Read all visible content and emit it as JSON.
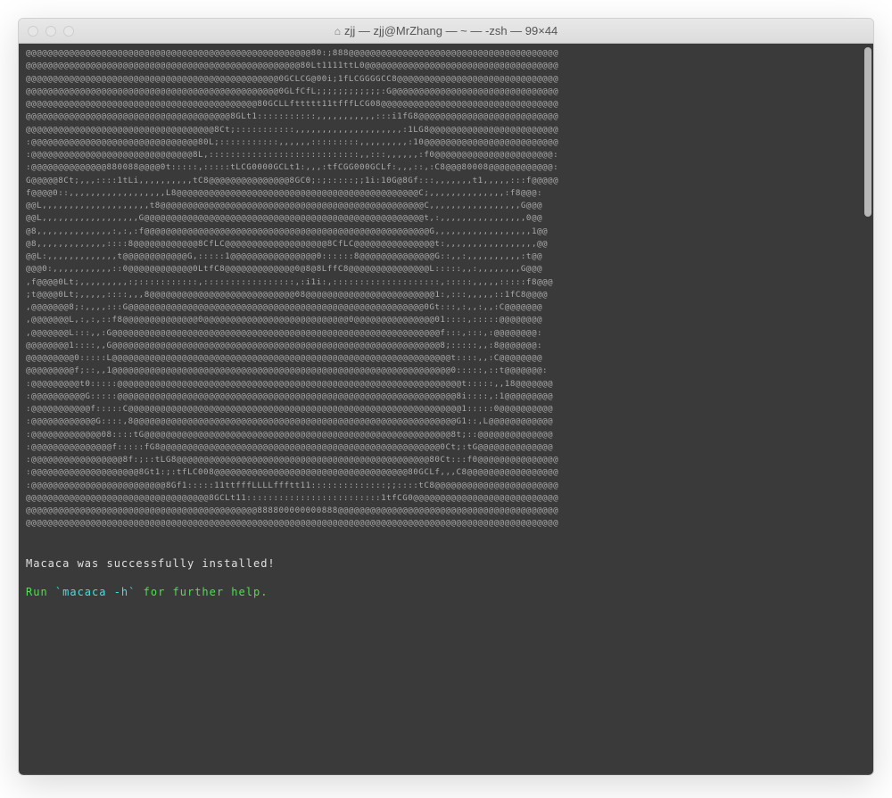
{
  "window": {
    "title": "zjj — zjj@MrZhang — ~ — -zsh — 99×44",
    "home_icon": "⌂"
  },
  "ascii_art": [
    "@@@@@@@@@@@@@@@@@@@@@@@@@@@@@@@@@@@@@@@@@@@@@@@@@@@@@80:;888@@@@@@@@@@@@@@@@@@@@@@@@@@@@@@@@@@@@@@@",
    "@@@@@@@@@@@@@@@@@@@@@@@@@@@@@@@@@@@@@@@@@@@@@@@@@@@80Lt1111ttL0@@@@@@@@@@@@@@@@@@@@@@@@@@@@@@@@@@@@",
    "@@@@@@@@@@@@@@@@@@@@@@@@@@@@@@@@@@@@@@@@@@@@@@@0GCLCG@00i;1fLCGGGGCC8@@@@@@@@@@@@@@@@@@@@@@@@@@@@@@",
    "@@@@@@@@@@@@@@@@@@@@@@@@@@@@@@@@@@@@@@@@@@@@@@@0GLfCfL;;;;;;;;;;;;:G@@@@@@@@@@@@@@@@@@@@@@@@@@@@@@@",
    "@@@@@@@@@@@@@@@@@@@@@@@@@@@@@@@@@@@@@@@@@@@80GCLLfttttt11tfffLCG08@@@@@@@@@@@@@@@@@@@@@@@@@@@@@@@@@",
    "@@@@@@@@@@@@@@@@@@@@@@@@@@@@@@@@@@@@@@8GLt1:::::::::::,,,,,,,,,,,:::i1fG8@@@@@@@@@@@@@@@@@@@@@@@@@@",
    "@@@@@@@@@@@@@@@@@@@@@@@@@@@@@@@@@@@8Ct;:::::::::::,,,,,,,,,,,,,,,,,,,,:1LG8@@@@@@@@@@@@@@@@@@@@@@@@",
    ":@@@@@@@@@@@@@@@@@@@@@@@@@@@@@@@80L;:::::::::::,,,,,,:::::::::,,,,,,,,,:10@@@@@@@@@@@@@@@@@@@@@@@@@",
    ":@@@@@@@@@@@@@@@@@@@@@@@@@@@@@@8L,::::::::::::::::::::::::::::,,:::,,,,,,:f0@@@@@@@@@@@@@@@@@@@@@@:",
    ":@@@@@@@@@@@@@@880088@@@@0t:::::,:::::tLCG0000GCLt1:,,,:tfCGG000GCLf:,,,::,:C8@@@80008@@@@@@@@@@@@:",
    "G@@@@@8Ct;,,,::::1tLi,,,,,,,,,,tC8@@@@@@@@@@@@@@@8GC0;:;:::::;;1i:10G@8Gf:::,,,,,,,t1,,,,,:::f@@@@@",
    "f@@@@0::,,,,,,,,,,,,,,,,,,L8@@@@@@@@@@@@@@@@@@@@@@@@@@@@@@@@@@@@@@@@@@@@@C;,,,,,,,,,,,,,,:f8@@@:",
    "@@L,,,,,,,,,,,,,,,,,,,,t8@@@@@@@@@@@@@@@@@@@@@@@@@@@@@@@@@@@@@@@@@@@@@@@@@C,,,,,,,,,,,,,,,,,G@@@",
    "@@L,,,,,,,,,,,,,,,,,,G@@@@@@@@@@@@@@@@@@@@@@@@@@@@@@@@@@@@@@@@@@@@@@@@@@@@t,:,,,,,,,,,,,,,,,,0@@",
    "@8,,,,,,,,,,,,,,:,:,:f@@@@@@@@@@@@@@@@@@@@@@@@@@@@@@@@@@@@@@@@@@@@@@@@@@@@@G,,,,,,,,,,,,,,,,,,1@@",
    "@8,,,,,,,,,,,,,::::8@@@@@@@@@@@@8CfLC@@@@@@@@@@@@@@@@@@@8CfLC@@@@@@@@@@@@@@@t:,,,,,,,,,,,,,,,,,@@",
    "@@L:,,,,,,,,,,,,,t@@@@@@@@@@@@G,:::::1@@@@@@@@@@@@@@@@0::::::8@@@@@@@@@@@@@@G::,,:,,,,,,,,,,:t@@",
    "@@@0:,,,,,,,,,,,::0@@@@@@@@@@@@0LtfC8@@@@@@@@@@@@@0@8@8LffC8@@@@@@@@@@@@@@@L:::::,,:,,,,,,,,G@@@",
    ",f@@@@0Lt;,,,,,,,,,:;:::::::::::,:::::::::::::::::,:i1i:,::::::::::::::::::::,:::::,,,,,:::::f8@@@",
    ";t@@@@0Lt;,,,,,::::,,,8@@@@@@@@@@@@@@@@@@@@@@@@@@@08@@@@@@@@@@@@@@@@@@@@@@@@1:,:::,,,,,::1fC8@@@@",
    ",@@@@@@@8;:,,,,:::G@@@@@@@@@@@@@@@@@@@@@@@@@@@@@@@@@@@@@@@@@@@@@@@@@@@@@@@0Gt:::,:,,:,,:C@@@@@@@",
    ",@@@@@@@L,:,:,::f8@@@@@@@@@@@@@@0@@@@@@@@@@@@@@@@@@@@@@@@@@@0@@@@@@@@@@@@@@@01::::,:::::@@@@@@@@",
    ",@@@@@@@L:::,,:G@@@@@@@@@@@@@@@@@@@@@@@@@@@@@@@@@@@@@@@@@@@@@@@@@@@@@@@@@@@@@f:::,:::,:@@@@@@@@:",
    "@@@@@@@@1::::,,G@@@@@@@@@@@@@@@@@@@@@@@@@@@@@@@@@@@@@@@@@@@@@@@@@@@@@@@@@@@@@8;:::::,,:8@@@@@@@:",
    "@@@@@@@@@0:::::L@@@@@@@@@@@@@@@@@@@@@@@@@@@@@@@@@@@@@@@@@@@@@@@@@@@@@@@@@@@@@@@t::::,,:C@@@@@@@@",
    "@@@@@@@@@f;::,,1@@@@@@@@@@@@@@@@@@@@@@@@@@@@@@@@@@@@@@@@@@@@@@@@@@@@@@@@@@@@@@@0:::::,::t@@@@@@@:",
    ":@@@@@@@@@t0:::::@@@@@@@@@@@@@@@@@@@@@@@@@@@@@@@@@@@@@@@@@@@@@@@@@@@@@@@@@@@@@@@@t:::::,,18@@@@@@@",
    ":@@@@@@@@@@G:::::@@@@@@@@@@@@@@@@@@@@@@@@@@@@@@@@@@@@@@@@@@@@@@@@@@@@@@@@@@@@@@@8i::::,:1@@@@@@@@@",
    ":@@@@@@@@@@@f:::::C@@@@@@@@@@@@@@@@@@@@@@@@@@@@@@@@@@@@@@@@@@@@@@@@@@@@@@@@@@@@@@1:::::0@@@@@@@@@@",
    ":@@@@@@@@@@@@G::::,8@@@@@@@@@@@@@@@@@@@@@@@@@@@@@@@@@@@@@@@@@@@@@@@@@@@@@@@@@@@@G1::,L@@@@@@@@@@@@",
    ":@@@@@@@@@@@@@08::::tG@@@@@@@@@@@@@@@@@@@@@@@@@@@@@@@@@@@@@@@@@@@@@@@@@@@@@@@@@8t;::@@@@@@@@@@@@@@",
    ":@@@@@@@@@@@@@@@f:::::fG8@@@@@@@@@@@@@@@@@@@@@@@@@@@@@@@@@@@@@@@@@@@@@@@@@@@@0Ct;:tG@@@@@@@@@@@@@@",
    ":@@@@@@@@@@@@@@@@@8f:;::tLG8@@@@@@@@@@@@@@@@@@@@@@@@@@@@@@@@@@@@@@@@@@@@@@@80Ct:::f0@@@@@@@@@@@@@@@",
    ":@@@@@@@@@@@@@@@@@@@@8Gt1:;:tfLC008@@@@@@@@@@@@@@@@@@@@@@@@@@@@@@@@@@@@80GCLf,,,C8@@@@@@@@@@@@@@@@@",
    ":@@@@@@@@@@@@@@@@@@@@@@@@@8Gf1:::::11ttfffLLLLffftt11::::::::::::::;;::::tC8@@@@@@@@@@@@@@@@@@@@@@@",
    "@@@@@@@@@@@@@@@@@@@@@@@@@@@@@@@@@@8GCLt11:::::::::::::::::::::::::1tfCG0@@@@@@@@@@@@@@@@@@@@@@@@@@@",
    "@@@@@@@@@@@@@@@@@@@@@@@@@@@@@@@@@@@@@@@@@@@888800000000888@@@@@@@@@@@@@@@@@@@@@@@@@@@@@@@@@@@@@@@@@",
    "@@@@@@@@@@@@@@@@@@@@@@@@@@@@@@@@@@@@@@@@@@@@@@@@@@@@@@@@@@@@@@@@@@@@@@@@@@@@@@@@@@@@@@@@@@@@@@@@@@@"
  ],
  "messages": {
    "success": "Macaca was successfully installed!",
    "run_prefix": "Run ",
    "run_command": "`macaca -h`",
    "run_suffix": " for further help."
  }
}
